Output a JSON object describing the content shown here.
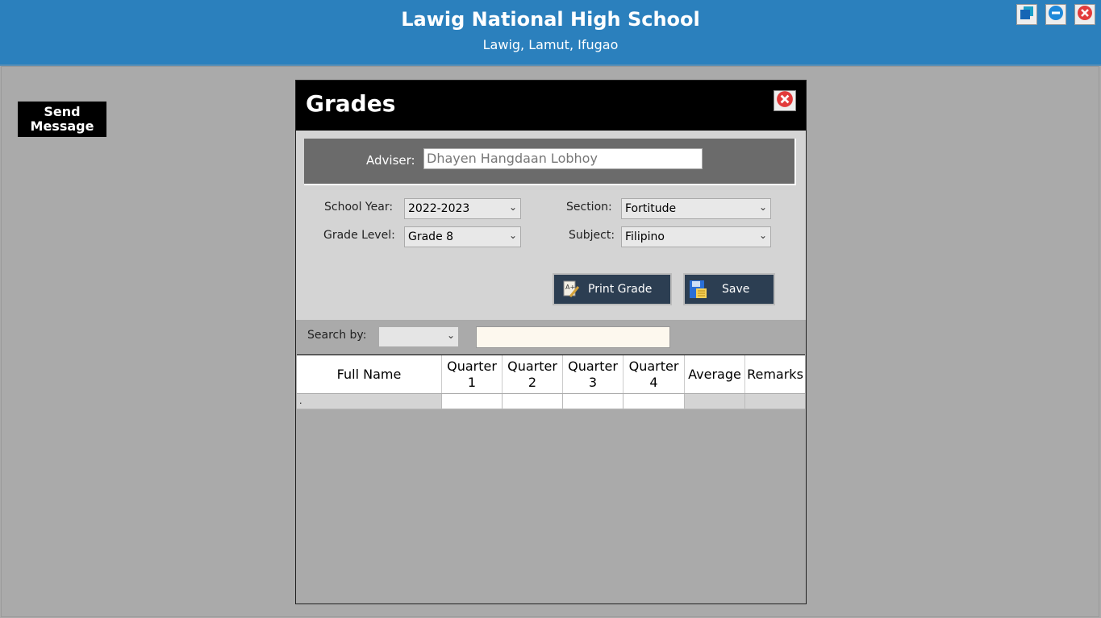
{
  "header": {
    "title": "Lawig National High School",
    "subtitle": "Lawig, Lamut, Ifugao",
    "colors": {
      "bar": "#2b80bd"
    }
  },
  "window_controls": [
    {
      "icon": "restore-icon"
    },
    {
      "icon": "minimize-icon"
    },
    {
      "icon": "close-icon"
    }
  ],
  "sidebar": {
    "send_message_line1": "Send",
    "send_message_line2": "Message"
  },
  "panel": {
    "title": "Grades",
    "adviser": {
      "label": "Adviser:",
      "value": "Dhayen Hangdaan Lobhoy"
    },
    "school_year": {
      "label": "School Year:",
      "value": "2022-2023"
    },
    "grade_level": {
      "label": "Grade Level:",
      "value": "Grade 8"
    },
    "section": {
      "label": "Section:",
      "value": "Fortitude"
    },
    "subject": {
      "label": "Subject:",
      "value": "Filipino"
    },
    "print_button": "Print Grade",
    "save_button": "Save",
    "search": {
      "label": "Search by:",
      "selected": "",
      "query": ""
    }
  },
  "table": {
    "columns": [
      {
        "line1": "Full Name",
        "line2": ""
      },
      {
        "line1": "Quarter",
        "line2": "1"
      },
      {
        "line1": "Quarter",
        "line2": "2"
      },
      {
        "line1": "Quarter",
        "line2": "3"
      },
      {
        "line1": "Quarter",
        "line2": "4"
      },
      {
        "line1": "Average",
        "line2": ""
      },
      {
        "line1": "Remarks",
        "line2": ""
      }
    ],
    "rows": [
      {
        "full_name": ".",
        "q1": "",
        "q2": "",
        "q3": "",
        "q4": "",
        "average": "",
        "remarks": ""
      }
    ]
  }
}
